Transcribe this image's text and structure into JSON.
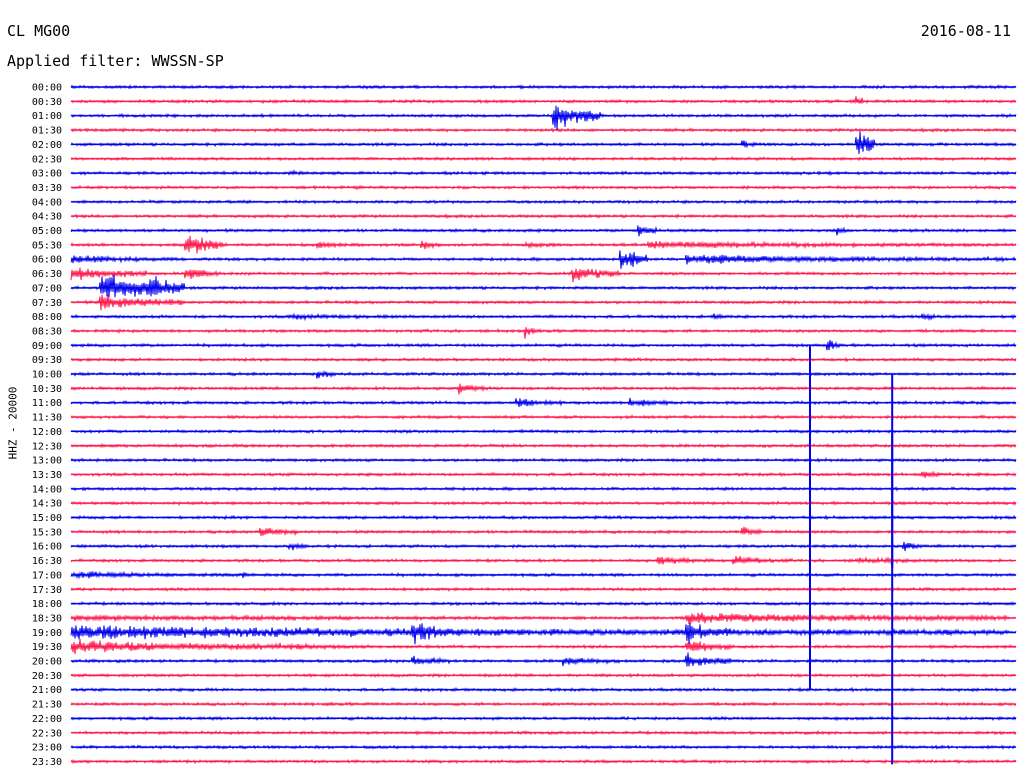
{
  "header": {
    "station": "CL MG00",
    "filter": "Applied filter: WWSSN-SP",
    "date": "2016-08-11"
  },
  "colors": {
    "trace_a": "#0000ee",
    "trace_b": "#ff1a4d",
    "text": "#000000",
    "background": "#ffffff"
  },
  "chart_data": {
    "type": "line",
    "title": "CL MG00",
    "subtitle": "Applied filter: WWSSN-SP",
    "date": "2016-08-11",
    "xlabel": "",
    "ylabel": "HHZ - 20000",
    "grid": false,
    "legend": "none",
    "series": [
      {
        "values": [
          "00:00",
          "01:00",
          "02:00",
          "03:00",
          "04:00",
          "05:00",
          "06:00",
          "07:00",
          "08:00",
          "09:00",
          "10:00",
          "11:00",
          "12:00",
          "13:00",
          "14:00",
          "15:00",
          "16:00",
          "17:00",
          "18:00",
          "19:00",
          "20:00",
          "21:00",
          "22:00",
          "23:00"
        ],
        "color": "#0000ee"
      },
      {
        "values": [
          "00:30",
          "01:30",
          "02:30",
          "03:30",
          "04:30",
          "05:30",
          "06:30",
          "07:30",
          "08:30",
          "09:30",
          "10:30",
          "11:30",
          "12:30",
          "13:30",
          "14:30",
          "15:30",
          "16:30",
          "17:30",
          "18:30",
          "19:30",
          "20:30",
          "21:30",
          "22:30",
          "23:30"
        ],
        "color": "#ff1a4d"
      }
    ],
    "row_labels": [
      "00:00",
      "00:30",
      "01:00",
      "01:30",
      "02:00",
      "02:30",
      "03:00",
      "03:30",
      "04:00",
      "04:30",
      "05:00",
      "05:30",
      "06:00",
      "06:30",
      "07:00",
      "07:30",
      "08:00",
      "08:30",
      "09:00",
      "09:30",
      "10:00",
      "10:30",
      "11:00",
      "11:30",
      "12:00",
      "12:30",
      "13:00",
      "13:30",
      "14:00",
      "14:30",
      "15:00",
      "15:30",
      "16:00",
      "16:30",
      "17:00",
      "17:30",
      "18:00",
      "18:30",
      "19:00",
      "19:30",
      "20:00",
      "20:30",
      "21:00",
      "21:30",
      "22:00",
      "22:30",
      "23:00",
      "23:30"
    ],
    "row_minutes": 30,
    "events": [
      {
        "row": "01:00",
        "start": 0.51,
        "end": 0.56,
        "amp": 2.6
      },
      {
        "row": "00:30",
        "start": 0.83,
        "end": 0.84,
        "amp": 1.4
      },
      {
        "row": "02:00",
        "start": 0.83,
        "end": 0.85,
        "amp": 3.2
      },
      {
        "row": "02:00",
        "start": 0.71,
        "end": 0.73,
        "amp": 0.8
      },
      {
        "row": "03:00",
        "start": 0.23,
        "end": 0.26,
        "amp": 0.6
      },
      {
        "row": "05:00",
        "start": 0.6,
        "end": 0.62,
        "amp": 1.2
      },
      {
        "row": "05:00",
        "start": 0.81,
        "end": 0.82,
        "amp": 1.0
      },
      {
        "row": "05:30",
        "start": 0.12,
        "end": 0.16,
        "amp": 2.4
      },
      {
        "row": "05:30",
        "start": 0.26,
        "end": 0.31,
        "amp": 0.7
      },
      {
        "row": "05:30",
        "start": 0.37,
        "end": 0.39,
        "amp": 1.0
      },
      {
        "row": "05:30",
        "start": 0.48,
        "end": 0.53,
        "amp": 0.6
      },
      {
        "row": "05:30",
        "start": 0.61,
        "end": 0.99,
        "amp": 0.7
      },
      {
        "row": "06:00",
        "start": 0.0,
        "end": 0.12,
        "amp": 0.8
      },
      {
        "row": "06:00",
        "start": 0.58,
        "end": 0.61,
        "amp": 2.6
      },
      {
        "row": "06:00",
        "start": 0.65,
        "end": 0.99,
        "amp": 0.9
      },
      {
        "row": "06:30",
        "start": 0.0,
        "end": 0.08,
        "amp": 1.3
      },
      {
        "row": "06:30",
        "start": 0.12,
        "end": 0.16,
        "amp": 1.4
      },
      {
        "row": "06:30",
        "start": 0.53,
        "end": 0.58,
        "amp": 1.6
      },
      {
        "row": "07:00",
        "start": 0.03,
        "end": 0.12,
        "amp": 2.6
      },
      {
        "row": "07:00",
        "start": 0.08,
        "end": 0.12,
        "amp": 2.8
      },
      {
        "row": "07:30",
        "start": 0.03,
        "end": 0.12,
        "amp": 1.5
      },
      {
        "row": "08:00",
        "start": 0.23,
        "end": 0.45,
        "amp": 0.5
      },
      {
        "row": "08:00",
        "start": 0.68,
        "end": 0.71,
        "amp": 0.6
      },
      {
        "row": "08:00",
        "start": 0.9,
        "end": 0.94,
        "amp": 0.6
      },
      {
        "row": "08:30",
        "start": 0.48,
        "end": 0.49,
        "amp": 1.4
      },
      {
        "row": "09:00",
        "start": 0.8,
        "end": 0.82,
        "amp": 1.2
      },
      {
        "row": "10:00",
        "start": 0.26,
        "end": 0.28,
        "amp": 1.0
      },
      {
        "row": "10:30",
        "start": 0.41,
        "end": 0.44,
        "amp": 1.0
      },
      {
        "row": "11:00",
        "start": 0.47,
        "end": 0.52,
        "amp": 0.9
      },
      {
        "row": "11:00",
        "start": 0.59,
        "end": 0.64,
        "amp": 0.9
      },
      {
        "row": "13:30",
        "start": 0.9,
        "end": 0.92,
        "amp": 1.0
      },
      {
        "row": "15:30",
        "start": 0.2,
        "end": 0.24,
        "amp": 1.1
      },
      {
        "row": "15:30",
        "start": 0.71,
        "end": 0.73,
        "amp": 1.1
      },
      {
        "row": "16:00",
        "start": 0.23,
        "end": 0.25,
        "amp": 0.9
      },
      {
        "row": "16:00",
        "start": 0.88,
        "end": 0.9,
        "amp": 1.2
      },
      {
        "row": "16:30",
        "start": 0.62,
        "end": 0.68,
        "amp": 0.8
      },
      {
        "row": "16:30",
        "start": 0.7,
        "end": 0.76,
        "amp": 0.9
      },
      {
        "row": "16:30",
        "start": 0.83,
        "end": 0.99,
        "amp": 0.5
      },
      {
        "row": "17:00",
        "start": 0.0,
        "end": 0.18,
        "amp": 0.7
      },
      {
        "row": "17:00",
        "start": 0.18,
        "end": 0.21,
        "amp": 0.5
      },
      {
        "row": "18:30",
        "start": 0.0,
        "end": 0.99,
        "amp": 0.5
      },
      {
        "row": "18:30",
        "start": 0.65,
        "end": 0.99,
        "amp": 1.1
      },
      {
        "row": "19:00",
        "start": 0.0,
        "end": 0.99,
        "amp": 1.2
      },
      {
        "row": "19:00",
        "start": 0.36,
        "end": 0.42,
        "amp": 2.0
      },
      {
        "row": "19:00",
        "start": 0.65,
        "end": 0.7,
        "amp": 2.0
      },
      {
        "row": "19:30",
        "start": 0.0,
        "end": 0.22,
        "amp": 1.3
      },
      {
        "row": "19:30",
        "start": 0.22,
        "end": 0.35,
        "amp": 0.6
      },
      {
        "row": "19:30",
        "start": 0.65,
        "end": 0.7,
        "amp": 1.4
      },
      {
        "row": "20:00",
        "start": 0.52,
        "end": 0.58,
        "amp": 0.9
      },
      {
        "row": "20:00",
        "start": 0.65,
        "end": 0.7,
        "amp": 1.5
      },
      {
        "row": "20:00",
        "start": 0.36,
        "end": 0.4,
        "amp": 1.0
      }
    ],
    "spikes": [
      {
        "row": "09:00",
        "pos": 0.782,
        "up": 0.0,
        "down": 24.0
      },
      {
        "row": "10:00",
        "pos": 0.869,
        "up": 0.0,
        "down": 25.0
      },
      {
        "row": "15:00",
        "pos": 0.782,
        "up": 7.0,
        "down": 1.5
      },
      {
        "row": "16:00",
        "pos": 0.869,
        "up": 8.0,
        "down": 1.5
      },
      {
        "row": "23:00",
        "pos": 0.869,
        "up": 1.0,
        "down": 1.2
      }
    ]
  }
}
